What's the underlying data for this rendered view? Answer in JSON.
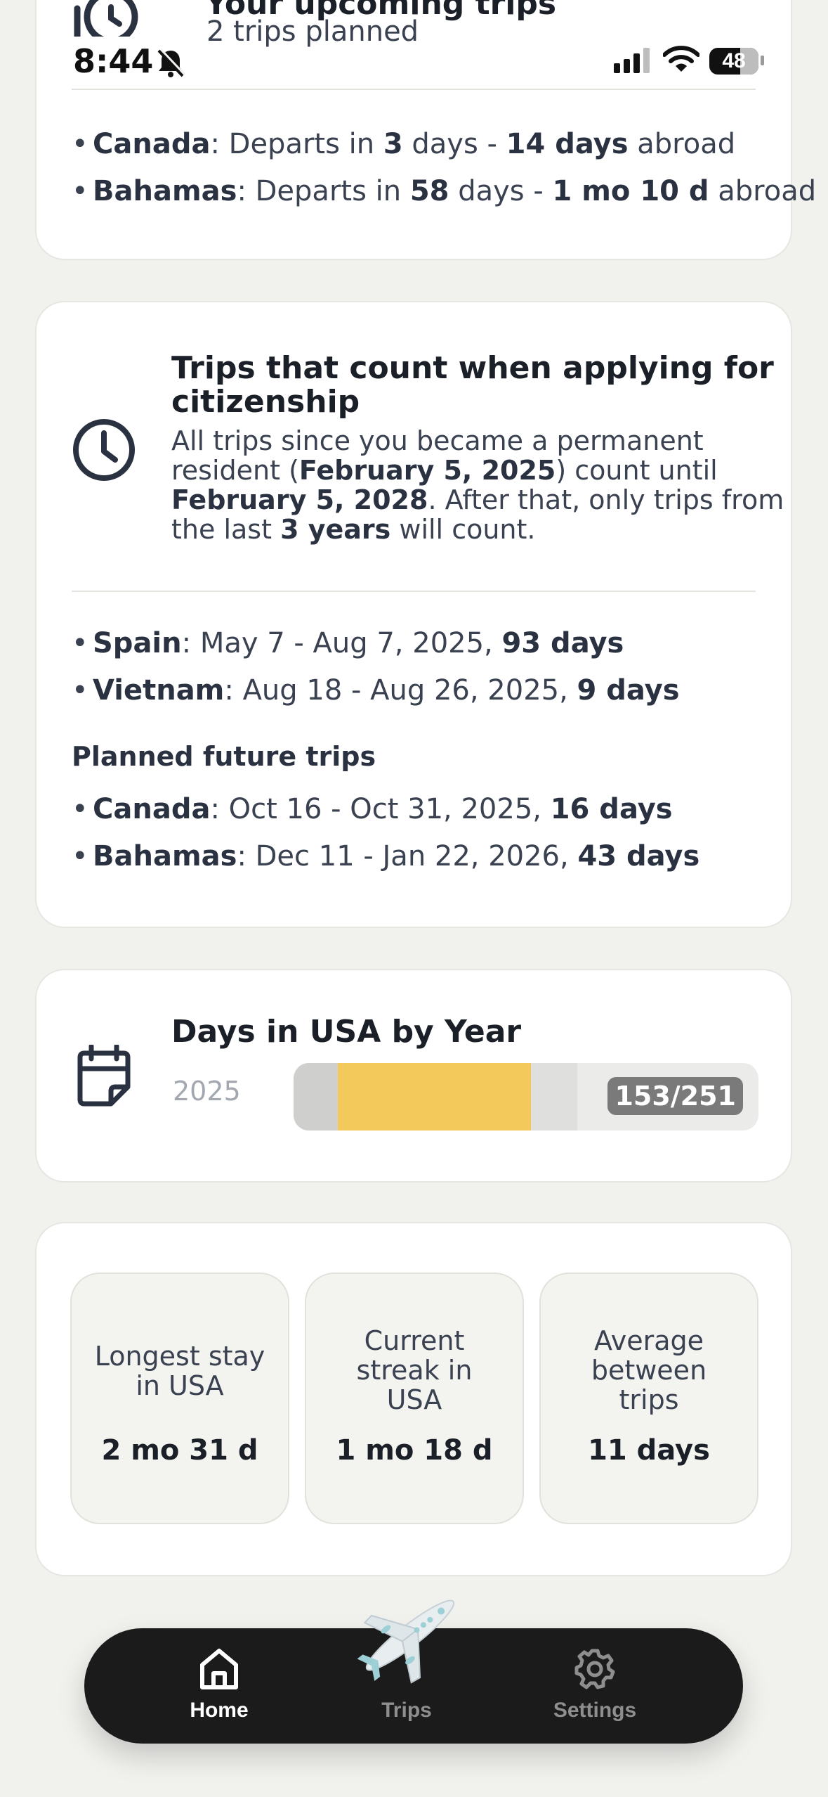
{
  "status_bar": {
    "time": "8:44",
    "battery": "48"
  },
  "upcoming": {
    "title": "Your upcoming trips",
    "subtitle": "2 trips planned",
    "trips": [
      {
        "country": "Canada",
        "pre": ": Departs in ",
        "days": "3",
        "mid": " days - ",
        "duration": "14 days",
        "post": " abroad"
      },
      {
        "country": "Bahamas",
        "pre": ": Departs in ",
        "days": "58",
        "mid": " days - ",
        "duration": "1 mo 10 d",
        "post": " abroad"
      }
    ]
  },
  "citizenship": {
    "title_line1": "Trips that count when applying for",
    "title_line2": "citizenship",
    "desc_l1": "All trips since you became a permanent",
    "desc_l2_pre": "resident (",
    "desc_l2_date": "February 5, 2025",
    "desc_l2_post": ") count until",
    "desc_l3_date": "February 5, 2028",
    "desc_l3_post": ". After that, only trips from",
    "desc_l4_pre": "the last ",
    "desc_l4_years": "3 years",
    "desc_l4_post": " will count.",
    "past_trips": [
      {
        "country": "Spain",
        "dates": ": May 7 - Aug 7, 2025, ",
        "days": "93 days"
      },
      {
        "country": "Vietnam",
        "dates": ": Aug 18 - Aug 26, 2025, ",
        "days": "9 days"
      }
    ],
    "future_heading": "Planned future trips",
    "future_trips": [
      {
        "country": "Canada",
        "dates": ": Oct 16 - Oct 31, 2025, ",
        "days": "16 days"
      },
      {
        "country": "Bahamas",
        "dates": ": Dec 11 - Jan 22, 2026, ",
        "days": "43 days"
      }
    ]
  },
  "days_in_usa": {
    "title": "Days in USA by Year",
    "year": "2025",
    "count_label": "153/251",
    "bar": {
      "elapsed_fraction": 0.61,
      "gray_fraction": 0.095,
      "yellow_fraction": 0.415
    }
  },
  "stats": [
    {
      "label_l1": "Longest stay",
      "label_l2": "in USA",
      "label_l3": "",
      "value": "2 mo 31 d"
    },
    {
      "label_l1": "Current",
      "label_l2": "streak in",
      "label_l3": "USA",
      "value": "1 mo 18 d"
    },
    {
      "label_l1": "Average",
      "label_l2": "between",
      "label_l3": "trips",
      "value": "11 days"
    }
  ],
  "nav": {
    "items": [
      {
        "label": "Home",
        "icon": "home-icon",
        "active": true
      },
      {
        "label": "Trips",
        "icon": "plane-icon",
        "active": false
      },
      {
        "label": "Settings",
        "icon": "gear-icon",
        "active": false
      }
    ]
  },
  "colors": {
    "background": "#f1f1ee",
    "card": "#ffffff",
    "text_dark": "#1b1f27",
    "bar_yellow": "#f3c95c",
    "bar_gray": "#cfcfcd",
    "bar_track": "#ebebea",
    "badge": "#7a7a7a",
    "nav_bg": "#1b1b1b"
  }
}
